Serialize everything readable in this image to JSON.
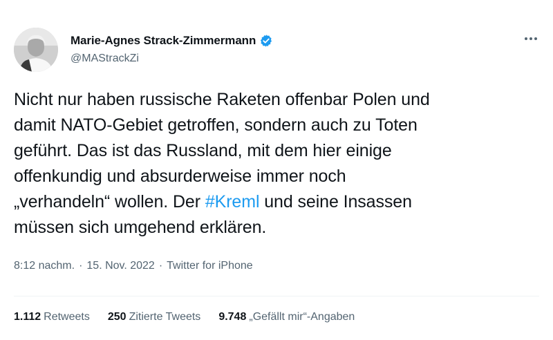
{
  "author": {
    "name": "Marie-Agnes Strack-Zimmermann",
    "handle": "@MAStrackZi",
    "verified_color": "#1d9bf0"
  },
  "tweet": {
    "text_before": "Nicht nur haben russische Raketen offenbar Polen und\ndamit NATO-Gebiet getroffen, sondern auch zu Toten\ngeführt. Das ist das Russland, mit dem hier einige\noffenkundig und absurderweise immer noch\n„verhandeln“ wollen. Der ",
    "hashtag": "#Kreml",
    "text_after": " und seine Insassen\nmüssen sich umgehend erklären.",
    "hashtag_color": "#1d9bf0"
  },
  "meta": {
    "time": "8:12 nachm.",
    "separator": "·",
    "date": "15. Nov. 2022",
    "source": "Twitter for iPhone"
  },
  "stats": [
    {
      "count": "1.112",
      "label": "Retweets"
    },
    {
      "count": "250",
      "label": "Zitierte Tweets"
    },
    {
      "count": "9.748",
      "label": "„Gefällt mir“-Angaben"
    }
  ]
}
